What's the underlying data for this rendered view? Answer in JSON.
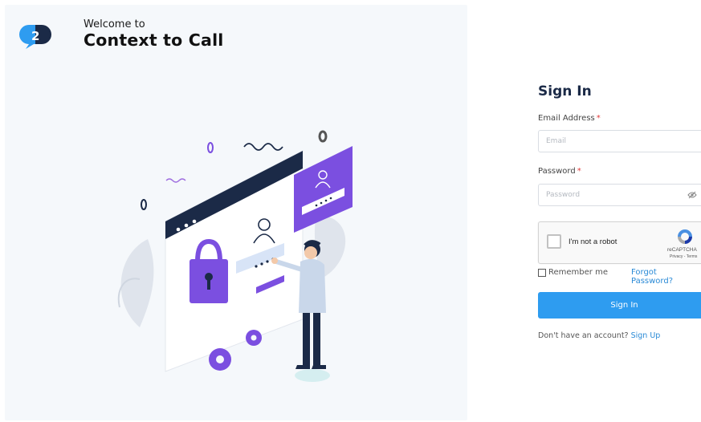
{
  "brand": {
    "welcome_prefix": "Welcome to",
    "app_name": "Context to Call",
    "logo_icon": "c2c-logo-icon",
    "primary_color": "#1b2a47",
    "accent_color": "#2e9cf0"
  },
  "illustration": {
    "icon": "secure-login-illustration-icon"
  },
  "signin": {
    "title": "Sign In",
    "email_label": "Email Address",
    "required_mark": "*",
    "email_placeholder": "Email",
    "email_value": "",
    "password_label": "Password",
    "password_placeholder": "Password",
    "password_value": "",
    "toggle_visibility_icon": "eye-off-icon",
    "recaptcha": {
      "label": "I'm not a robot",
      "brand": "reCAPTCHA",
      "links": "Privacy - Terms",
      "checked": false
    },
    "remember_label": "Remember me",
    "remember_checked": false,
    "forgot_label": "Forgot Password?",
    "button_label": "Sign In",
    "signup_prompt": "Don't have an account?",
    "signup_link": "Sign Up"
  }
}
